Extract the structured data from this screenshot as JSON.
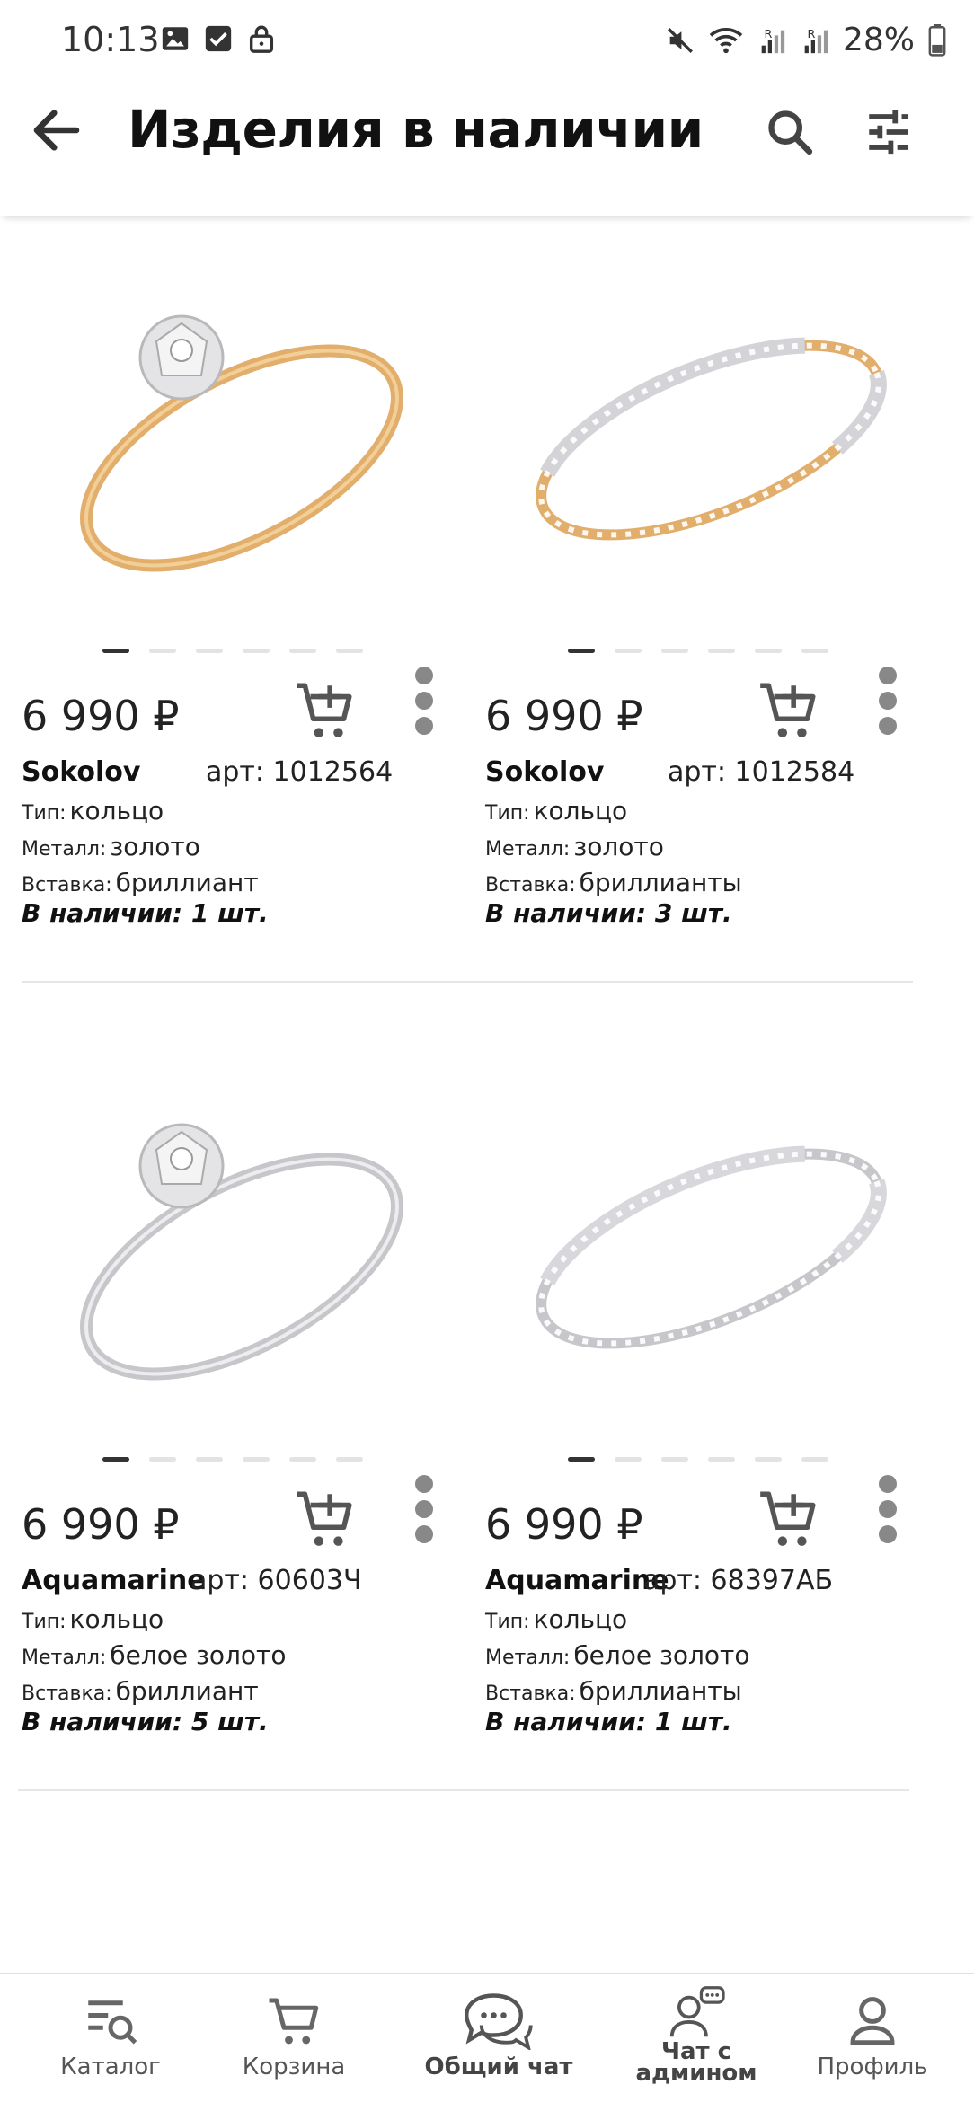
{
  "status_bar": {
    "time": "10:13",
    "battery": "28%"
  },
  "app_bar": {
    "title": "Изделия в наличии"
  },
  "products": [
    {
      "price": "6 990 ₽",
      "brand": "Sokolov",
      "article": "арт: 1012564",
      "type_label": "Тип:",
      "type_value": "кольцо",
      "metal_label": "Металл:",
      "metal_value": "золото",
      "insert_label": "Вставка:",
      "insert_value": "бриллиант",
      "stock": "В наличии: 1 шт.",
      "metal_color": "#e0aa66",
      "image_index": 1
    },
    {
      "price": "6 990 ₽",
      "brand": "Sokolov",
      "article": "арт: 1012584",
      "type_label": "Тип:",
      "type_value": "кольцо",
      "metal_label": "Металл:",
      "metal_value": "золото",
      "insert_label": "Вставка:",
      "insert_value": "бриллианты",
      "stock": "В наличии: 3 шт.",
      "metal_color": "#e0aa66",
      "image_index": 1
    },
    {
      "price": "6 990 ₽",
      "brand": "Aquamarine",
      "article": "арт: 60603Ч",
      "type_label": "Тип:",
      "type_value": "кольцо",
      "metal_label": "Металл:",
      "metal_value": "белое  золото",
      "insert_label": "Вставка:",
      "insert_value": "бриллиант",
      "stock": "В наличии: 5 шт.",
      "metal_color": "#c9c9cc",
      "image_index": 1
    },
    {
      "price": "6 990 ₽",
      "brand": "Aquamarine",
      "article": "арт: 68397АБ",
      "type_label": "Тип:",
      "type_value": "кольцо",
      "metal_label": "Металл:",
      "metal_value": "белое  золото",
      "insert_label": "Вставка:",
      "insert_value": "бриллианты",
      "stock": "В наличии: 1 шт.",
      "metal_color": "#c9c9cc",
      "image_index": 1
    }
  ],
  "bottom_nav": {
    "catalog": "Каталог",
    "cart": "Корзина",
    "general_chat": "Общий чат",
    "admin_chat_line1": "Чат с",
    "admin_chat_line2": "админом",
    "profile": "Профиль"
  }
}
